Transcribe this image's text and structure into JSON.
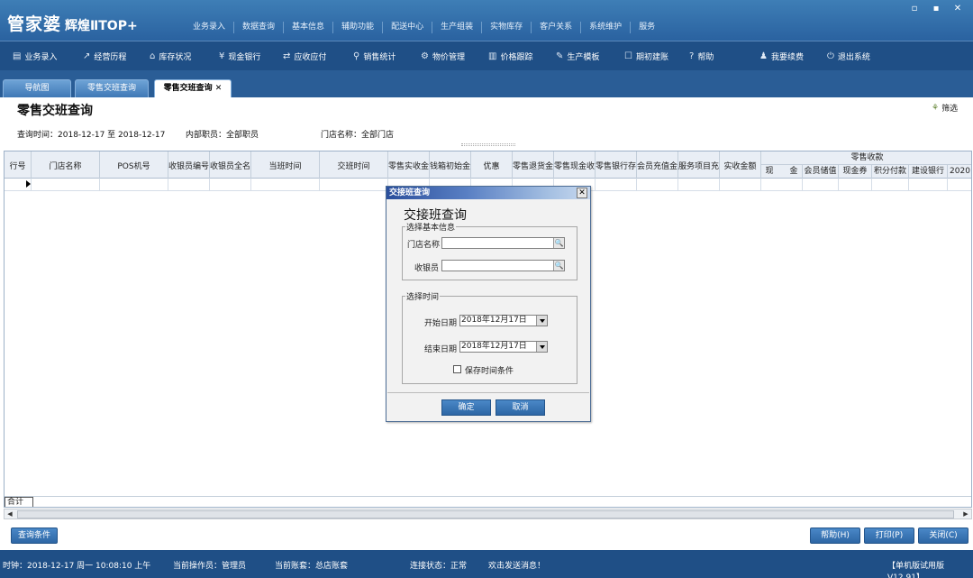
{
  "app": {
    "brand_main": "管家婆",
    "brand_sub": "辉煌ⅡTOP+",
    "top_menu": [
      "业务录入",
      "数据查询",
      "基本信息",
      "辅助功能",
      "配送中心",
      "生产组装",
      "实物库存",
      "客户关系",
      "系统维护",
      "服务"
    ],
    "window_controls": [
      "▫",
      "▪",
      "✕"
    ]
  },
  "toolbar": [
    {
      "label": "业务录入",
      "icon": "doc-icon"
    },
    {
      "label": "经营历程",
      "icon": "chart-icon"
    },
    {
      "label": "库存状况",
      "icon": "home-icon"
    },
    {
      "label": "现金银行",
      "icon": "yen-icon"
    },
    {
      "label": "应收应付",
      "icon": "exchange-icon"
    },
    {
      "label": "销售统计",
      "icon": "search-icon"
    },
    {
      "label": "物价管理",
      "icon": "gear-icon"
    },
    {
      "label": "价格跟踪",
      "icon": "bar-icon"
    },
    {
      "label": "生产模板",
      "icon": "wrench-icon"
    },
    {
      "label": "期初建账",
      "icon": "edit-icon"
    },
    {
      "label": "帮助",
      "icon": "help-icon"
    },
    {
      "label": "我要续费",
      "icon": "user-icon"
    },
    {
      "label": "退出系统",
      "icon": "power-icon"
    }
  ],
  "tabs": [
    "导航图",
    "零售交班查询",
    "零售交班查询"
  ],
  "page": {
    "title": "零售交班查询",
    "filter": "筛选",
    "query_time_label": "查询时间：",
    "query_time_value": "2018-12-17 至 2018-12-17",
    "staff_label": "内部职员：",
    "staff_value": "全部职员",
    "store_label": "门店名称：",
    "store_value": "全部门店"
  },
  "grid": {
    "columns": [
      "行号",
      "门店名称",
      "POS机号",
      "收银员编号",
      "收银员全名",
      "当班时间",
      "交班时间",
      "零售实收金",
      "钱箱初始金",
      "优惠",
      "零售退货金",
      "零售现金收",
      "零售银行存",
      "会员充值金",
      "服务项目充",
      "实收金额"
    ],
    "group_title": "零售收款",
    "group_columns": [
      "现　　金",
      "会员储值",
      "现金券",
      "积分付款",
      "建设银行",
      "2020"
    ],
    "total_label": "合计"
  },
  "buttons": {
    "query_conditions": "查询条件",
    "help": "帮助(H)",
    "print": "打印(P)",
    "close": "关闭(C)"
  },
  "status": {
    "clock": "时钟：2018-12-17 周一 10:08:10 上午",
    "operator": "当前操作员：管理员",
    "account": "当前账套：总店账套",
    "connection": "连接状态：正常",
    "message": "欢击发送消息！",
    "version": "【单机版试用版V12.91】"
  },
  "dialog": {
    "title": "交接班查询",
    "close": "✕",
    "heading": "交接班查询",
    "basic_legend": "选择基本信息",
    "store_label": "门店名称",
    "store_value": "",
    "cashier_label": "收银员",
    "cashier_value": "",
    "time_legend": "选择时间",
    "start_label": "开始日期",
    "start_value": "2018年12月17日",
    "end_label": "结束日期",
    "end_value": "2018年12月17日",
    "save_label": "保存时间条件",
    "ok": "确定",
    "cancel": "取消"
  }
}
